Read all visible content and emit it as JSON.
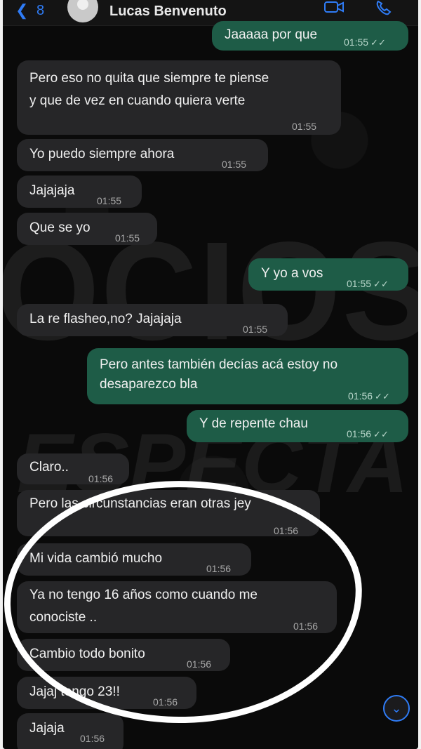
{
  "header": {
    "back_icon": "chevron-left-icon",
    "back_count": "8",
    "contact_name": "Lucas Benvenuto",
    "video_icon": "video-camera-icon",
    "call_icon": "phone-icon"
  },
  "watermark": {
    "line1": "OCIOS",
    "line2": "ESPECTA"
  },
  "messages": [
    {
      "dir": "out",
      "text": "Jaaaaa por que",
      "time": "01:55",
      "ticks": "✓✓"
    },
    {
      "dir": "in",
      "line1": "Pero eso no quita que siempre te piense",
      "line2": "y que de vez en cuando quiera verte",
      "time": "01:55"
    },
    {
      "dir": "in",
      "text": "Yo puedo siempre ahora",
      "time": "01:55"
    },
    {
      "dir": "in",
      "text": "Jajajaja",
      "time": "01:55"
    },
    {
      "dir": "in",
      "text": "Que se yo",
      "time": "01:55"
    },
    {
      "dir": "out",
      "text": "Y yo a vos",
      "time": "01:55",
      "ticks": "✓✓"
    },
    {
      "dir": "in",
      "text": "La re flasheo,no? Jajajaja",
      "time": "01:55"
    },
    {
      "dir": "out",
      "line1": "Pero antes también decías acá estoy no",
      "line2": "desaparezco bla",
      "time": "01:56",
      "ticks": "✓✓"
    },
    {
      "dir": "out",
      "text": "Y de repente  chau",
      "time": "01:56",
      "ticks": "✓✓"
    },
    {
      "dir": "in",
      "text": "Claro..",
      "time": "01:56"
    },
    {
      "dir": "in",
      "text": "Pero las circunstancias eran otras jey",
      "time": "01:56"
    },
    {
      "dir": "in",
      "text": "Mi vida cambió mucho",
      "time": "01:56"
    },
    {
      "dir": "in",
      "line1": "Ya no tengo 16 años como cuando me",
      "line2": "conociste ..",
      "time": "01:56"
    },
    {
      "dir": "in",
      "text": "Cambio todo bonito",
      "time": "01:56"
    },
    {
      "dir": "in",
      "text": "Jajaj tengo 23!!",
      "time": "01:56"
    },
    {
      "dir": "in",
      "text": "Jajaja",
      "time": "01:56"
    }
  ],
  "scroll_down_icon": "chevron-down-icon",
  "highlight_color": "#ffffff",
  "outgoing_color": "#1e5c47",
  "incoming_color": "#262628",
  "accent_color": "#2f7cf6"
}
